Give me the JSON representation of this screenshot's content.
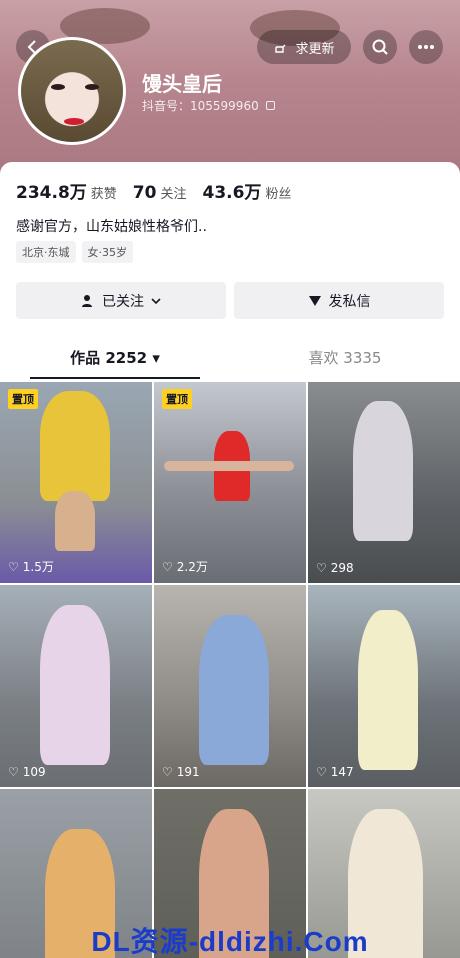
{
  "header": {
    "update_label": "求更新"
  },
  "profile": {
    "nickname": "馒头皇后",
    "douyin_id": "抖音号：105599960",
    "bio": "感谢官方，山东姑娘性格爷们..",
    "tags": [
      "北京·东城",
      "女·35岁"
    ]
  },
  "stats": [
    {
      "value": "234.8万",
      "label": "获赞"
    },
    {
      "value": "70",
      "label": "关注"
    },
    {
      "value": "43.6万",
      "label": "粉丝"
    }
  ],
  "actions": {
    "follow_label": "已关注",
    "message_label": "发私信"
  },
  "tabs": [
    {
      "label": "作品 2252 ▾"
    },
    {
      "label": "喜欢 3335"
    }
  ],
  "videos": [
    {
      "pinned": "置顶",
      "likes": "1.5万"
    },
    {
      "pinned": "置顶",
      "likes": "2.2万"
    },
    {
      "pinned": "",
      "likes": "298"
    },
    {
      "pinned": "",
      "likes": "109"
    },
    {
      "pinned": "",
      "likes": "191"
    },
    {
      "pinned": "",
      "likes": "147"
    },
    {
      "pinned": "",
      "likes": ""
    },
    {
      "pinned": "",
      "likes": ""
    },
    {
      "pinned": "",
      "likes": ""
    }
  ],
  "watermark": "DL资源-dldizhi.Com",
  "colors": {
    "accent": "#161823",
    "pin_bg": "#fdd022",
    "watermark": "#1a3cc9"
  }
}
